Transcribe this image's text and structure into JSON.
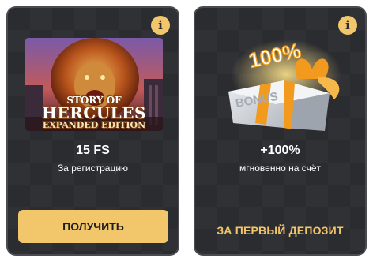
{
  "cards": [
    {
      "game_title_line1": "STORY OF",
      "game_title_line2": "HERCULES",
      "game_title_line3": "EXPANDED EDITION",
      "amount": "15 FS",
      "description": "За регистрацию",
      "button_label": "ПОЛУЧИТЬ",
      "info_icon": "info-icon"
    },
    {
      "badge_text": "100%",
      "box_label": "BONUS",
      "amount": "+100%",
      "description": "мгновенно на счёт",
      "link_label": "ЗА ПЕРВЫЙ ДЕПОЗИТ",
      "info_icon": "info-icon"
    }
  ],
  "colors": {
    "card_bg": "#2b2c30",
    "accent": "#f2c66a",
    "text": "#ffffff"
  }
}
